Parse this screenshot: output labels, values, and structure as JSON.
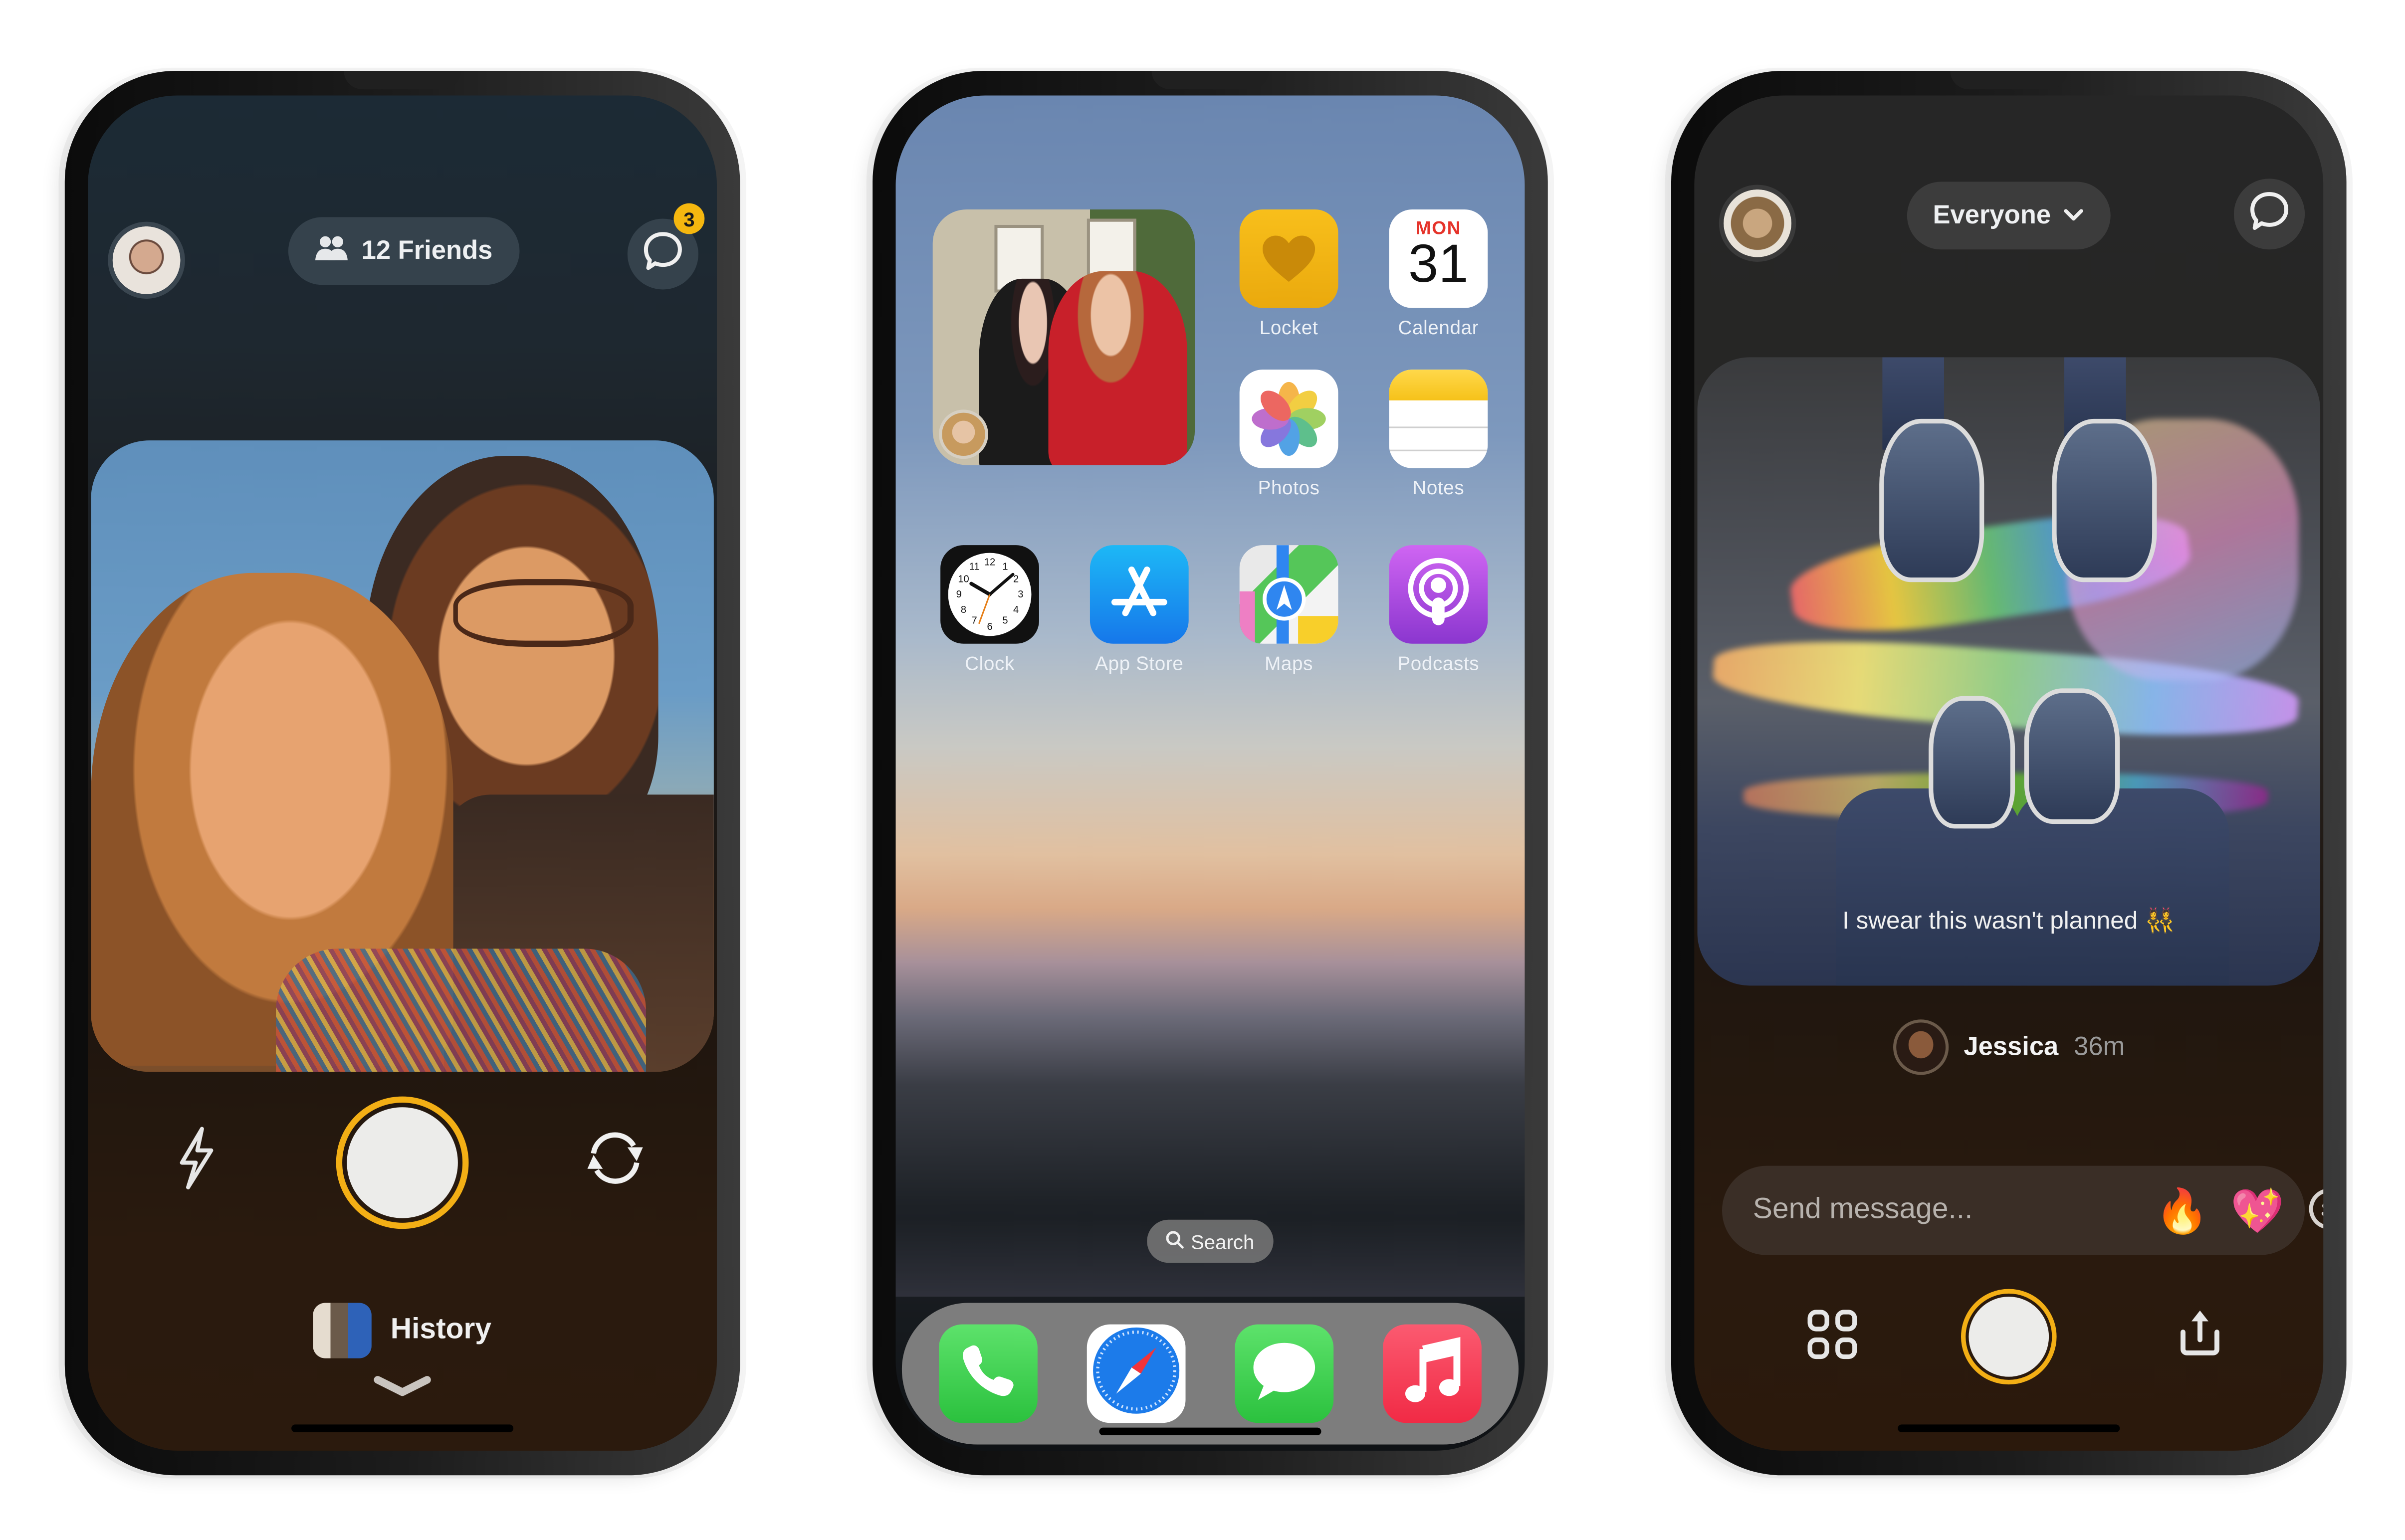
{
  "screens": [
    {
      "name": "camera",
      "friends_pill": {
        "icon": "people-icon",
        "label": "12 Friends"
      },
      "profile_avatar": "profile-avatar",
      "messages": {
        "icon": "chat-bubble-icon",
        "badge": "3"
      },
      "controls": {
        "flash_icon": "flash-icon",
        "shutter": "shutter-button",
        "flip_icon": "flip-camera-icon"
      },
      "history": {
        "label": "History",
        "chevron_icon": "chevron-down-icon"
      },
      "accent_color": "#f3af15"
    },
    {
      "name": "home_screen",
      "widget": {
        "label": "Locket widget photo"
      },
      "apps": [
        {
          "label": "Locket",
          "icon": "heart-icon"
        },
        {
          "label": "Calendar",
          "icon": "calendar-icon",
          "day_of_week": "MON",
          "day": "31"
        },
        {
          "label": "Photos",
          "icon": "photos-flower-icon"
        },
        {
          "label": "Notes",
          "icon": "notes-icon"
        },
        {
          "label": "Clock",
          "icon": "clock-icon"
        },
        {
          "label": "App Store",
          "icon": "app-store-icon"
        },
        {
          "label": "Maps",
          "icon": "maps-icon"
        },
        {
          "label": "Podcasts",
          "icon": "podcasts-icon"
        }
      ],
      "search": {
        "label": "Search",
        "icon": "search-icon"
      },
      "dock": [
        {
          "label": "Phone",
          "icon": "phone-icon"
        },
        {
          "label": "Safari",
          "icon": "safari-compass-icon"
        },
        {
          "label": "Messages",
          "icon": "message-bubble-icon"
        },
        {
          "label": "Music",
          "icon": "music-note-icon"
        }
      ]
    },
    {
      "name": "feed",
      "audience_pill": {
        "label": "Everyone",
        "icon": "chevron-down-icon"
      },
      "messages": {
        "icon": "chat-bubble-icon"
      },
      "post": {
        "caption": "I swear this wasn't planned 👯‍♀️",
        "author": "Jessica",
        "time": "36m"
      },
      "message_bar": {
        "placeholder": "Send message...",
        "reactions": [
          "🔥",
          "💖"
        ],
        "add_reaction_icon": "add-emoji-icon"
      },
      "controls": {
        "grid_icon": "grid-icon",
        "shutter": "shutter-button",
        "share_icon": "share-icon"
      }
    }
  ]
}
